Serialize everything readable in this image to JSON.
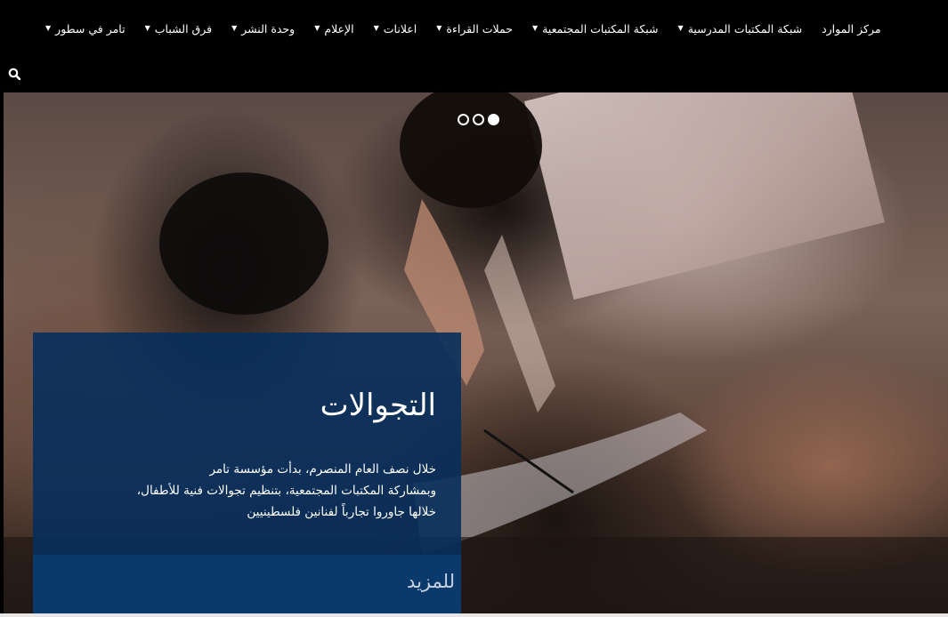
{
  "nav": {
    "items": [
      {
        "label": "تامر في سطور",
        "has_dropdown": true
      },
      {
        "label": "فرق الشباب",
        "has_dropdown": true
      },
      {
        "label": "وحدة النشر",
        "has_dropdown": true
      },
      {
        "label": "الإعلام",
        "has_dropdown": true
      },
      {
        "label": "اعلانات",
        "has_dropdown": true
      },
      {
        "label": "حملات القراءة",
        "has_dropdown": true
      },
      {
        "label": "شبكة المكتبات المجتمعية",
        "has_dropdown": true
      },
      {
        "label": "شبكة المكتبات المدرسية",
        "has_dropdown": true
      },
      {
        "label": "مركز الموارد",
        "has_dropdown": false
      }
    ],
    "caret": "▼"
  },
  "search": {
    "icon": "search-icon"
  },
  "slider": {
    "slide_count": 3,
    "active_index": 0,
    "card": {
      "title": "التجوالات",
      "text_lines": [
        "خلال نصف العام المنصرم، بدأت مؤسسة تامر",
        "وبمشاركة المكتبات المجتمعية، بتنظيم تجوالات فنية للأطفال،",
        "خلالها جاوروا تجارباً لفنانين فلسطينيين"
      ],
      "more_label": "للمزيد"
    }
  },
  "colors": {
    "topbar": "#000000",
    "card": "#072f5c",
    "more_bar": "#0a3a6c",
    "more_text": "#c9d2e0"
  }
}
